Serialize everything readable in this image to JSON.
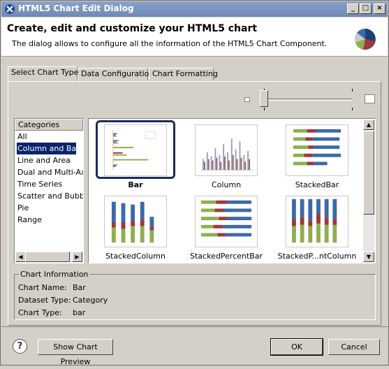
{
  "window": {
    "title": "HTML5 Chart Edit Dialog"
  },
  "header": {
    "heading": "Create, edit and customize your HTML5 chart",
    "description": "The dialog allows to configure all the information of the HTML5 Chart Component."
  },
  "tabs": [
    {
      "label": "Select Chart Type",
      "active": true
    },
    {
      "label": "Data Configuration",
      "active": false
    },
    {
      "label": "Chart Formatting",
      "active": false
    }
  ],
  "categories": {
    "header": "Categories",
    "items": [
      "All",
      "Column and Bar",
      "Line and Area",
      "Dual and Multi-Axis",
      "Time Series",
      "Scatter and Bubble",
      "Pie",
      "Range"
    ],
    "selected": "Column and Bar"
  },
  "chart_types": [
    {
      "label": "Bar",
      "selected": true
    },
    {
      "label": "Column",
      "selected": false
    },
    {
      "label": "StackedBar",
      "selected": false
    },
    {
      "label": "StackedColumn",
      "selected": false
    },
    {
      "label": "StackedPercentBar",
      "selected": false
    },
    {
      "label": "StackedP...ntColumn",
      "selected": false
    }
  ],
  "chart_info": {
    "title": "Chart Information",
    "name_label": "Chart Name:",
    "name_value": "Bar",
    "dataset_label": "Dataset Type:",
    "dataset_value": "Category",
    "type_label": "Chart Type:",
    "type_value": "bar"
  },
  "footer": {
    "preview_label": "Show Chart Preview",
    "ok_label": "OK",
    "cancel_label": "Cancel"
  },
  "colors": {
    "blue": "#3b6aa8",
    "red": "#a0373c",
    "green": "#8db04c",
    "selection": "#0a246a"
  }
}
